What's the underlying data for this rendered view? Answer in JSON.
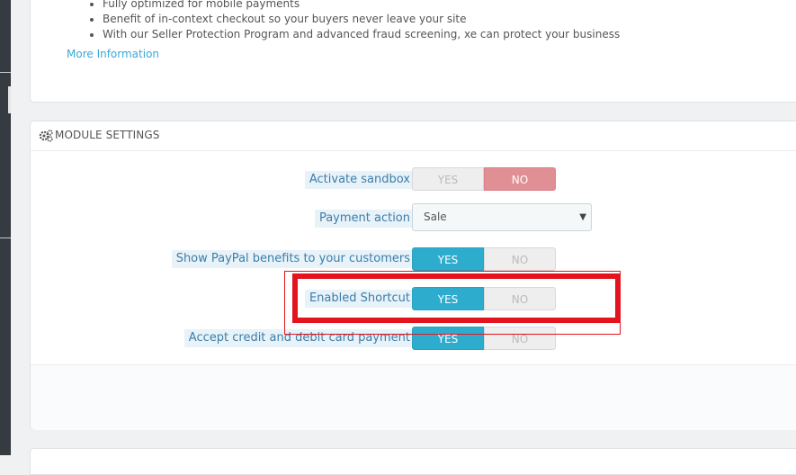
{
  "benefits": {
    "items": [
      "Fully optimized for mobile payments",
      "Benefit of in-context checkout so your buyers never leave your site",
      "With our Seller Protection Program and advanced fraud screening, xe can protect your business"
    ],
    "more_info_label": "More Information"
  },
  "module_settings": {
    "title": "MODULE SETTINGS",
    "icon": "cogs-icon",
    "rows": [
      {
        "label": "Activate sandbox",
        "yes_label": "YES",
        "no_label": "NO",
        "selected": "NO"
      },
      {
        "label": "Payment action",
        "value": "Sale"
      },
      {
        "label": "Show PayPal benefits to your customers",
        "yes_label": "YES",
        "no_label": "NO",
        "selected": "YES"
      },
      {
        "label": "Enabled Shortcut",
        "yes_label": "YES",
        "no_label": "NO",
        "selected": "YES"
      },
      {
        "label": "Accept credit and debit card payment",
        "yes_label": "YES",
        "no_label": "NO",
        "selected": "YES"
      }
    ]
  },
  "colors": {
    "accent_blue": "#2eacce",
    "no_red": "#e08f95",
    "highlight_red": "#e3141d",
    "link_blue": "#3aa9d6"
  }
}
